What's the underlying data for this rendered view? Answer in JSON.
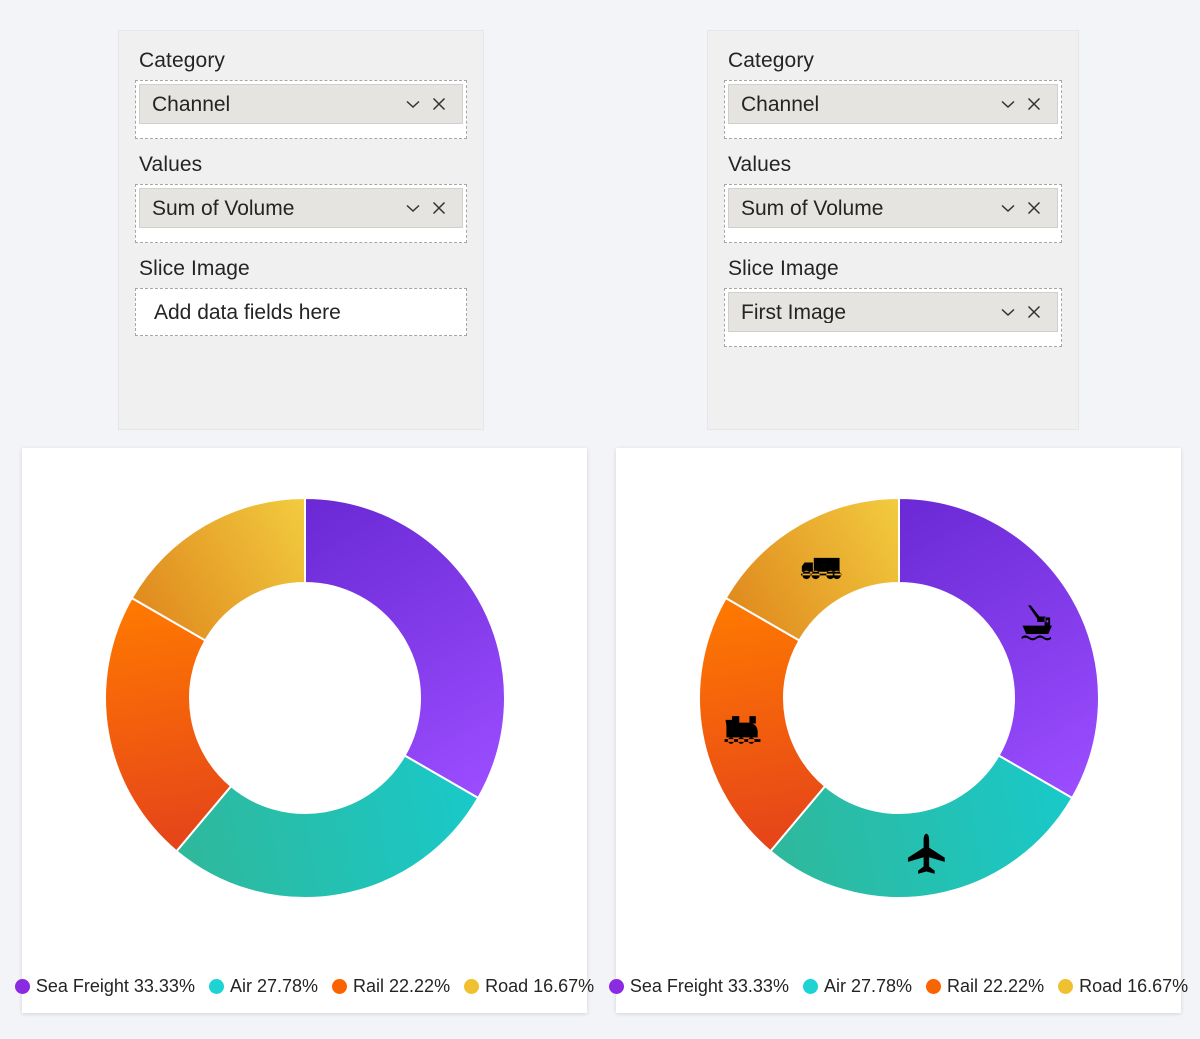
{
  "panels": [
    {
      "id": "left",
      "wells": [
        {
          "label": "Category",
          "value": "Channel",
          "filled": true
        },
        {
          "label": "Values",
          "value": "Sum of Volume",
          "filled": true
        },
        {
          "label": "Slice Image",
          "value": "Add data fields here",
          "filled": false
        }
      ]
    },
    {
      "id": "right",
      "wells": [
        {
          "label": "Category",
          "value": "Channel",
          "filled": true
        },
        {
          "label": "Values",
          "value": "Sum of Volume",
          "filled": true
        },
        {
          "label": "Slice Image",
          "value": "First Image",
          "filled": true
        }
      ]
    }
  ],
  "icons": {
    "chevron": "chevron-down-icon",
    "remove": "close-icon"
  },
  "chart_data": [
    {
      "type": "pie",
      "variant": "donut",
      "title": "",
      "show_slice_images": false,
      "start_angle_deg": 0,
      "direction": "clockwise",
      "legend_position": "bottom",
      "inner_radius_ratio": 0.575,
      "categories": [
        "Sea Freight",
        "Air",
        "Rail",
        "Road"
      ],
      "values": [
        33.33,
        27.78,
        22.22,
        16.67
      ],
      "labels": [
        "Sea Freight 33.33%",
        "Air 27.78%",
        "Rail 22.22%",
        "Road 16.67%"
      ],
      "colors": [
        "#8A2BE2",
        "#1DD3D3",
        "#FA6400",
        "#EFC030"
      ],
      "gradient_colors": [
        [
          "#6929D4",
          "#9B4DFF"
        ],
        [
          "#19C9C9",
          "#2FB89B"
        ],
        [
          "#E5431A",
          "#FF7A00"
        ],
        [
          "#E08A1E",
          "#F2CC3F"
        ]
      ],
      "slice_images": [
        null,
        null,
        null,
        null
      ]
    },
    {
      "type": "pie",
      "variant": "donut",
      "title": "",
      "show_slice_images": true,
      "start_angle_deg": 0,
      "direction": "clockwise",
      "legend_position": "bottom",
      "inner_radius_ratio": 0.575,
      "categories": [
        "Sea Freight",
        "Air",
        "Rail",
        "Road"
      ],
      "values": [
        33.33,
        27.78,
        22.22,
        16.67
      ],
      "labels": [
        "Sea Freight 33.33%",
        "Air 27.78%",
        "Rail 22.22%",
        "Road 16.67%"
      ],
      "colors": [
        "#8A2BE2",
        "#1DD3D3",
        "#FA6400",
        "#EFC030"
      ],
      "gradient_colors": [
        [
          "#6929D4",
          "#9B4DFF"
        ],
        [
          "#19C9C9",
          "#2FB89B"
        ],
        [
          "#E5431A",
          "#FF7A00"
        ],
        [
          "#E08A1E",
          "#F2CC3F"
        ]
      ],
      "slice_images": [
        "cargo-ship-icon",
        "airplane-icon",
        "train-icon",
        "truck-icon"
      ]
    }
  ]
}
